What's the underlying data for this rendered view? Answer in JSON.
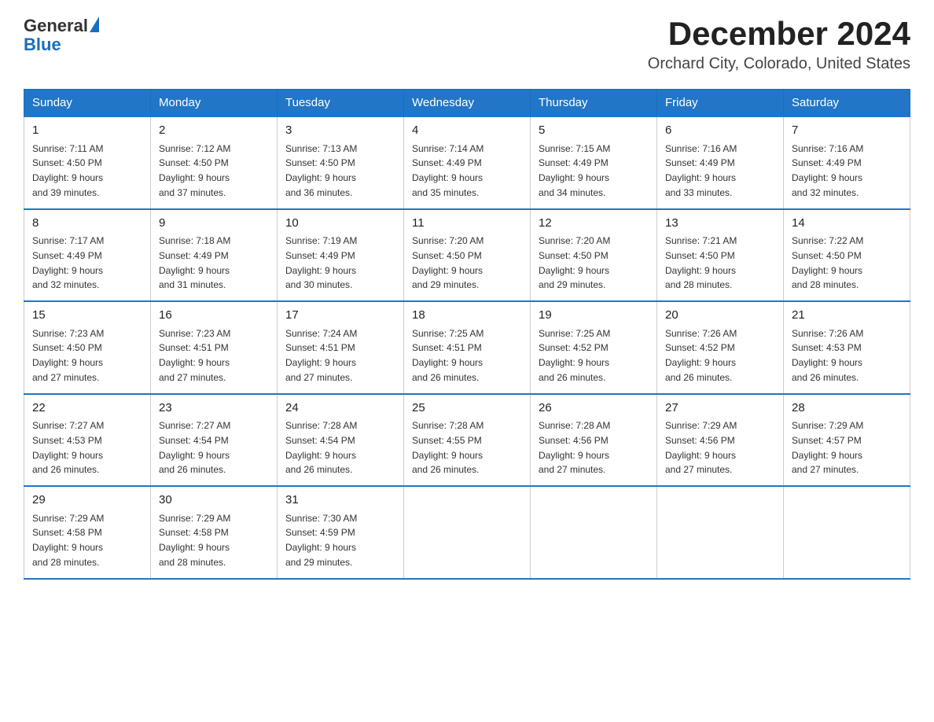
{
  "header": {
    "logo_general": "General",
    "logo_blue": "Blue",
    "month_title": "December 2024",
    "subtitle": "Orchard City, Colorado, United States"
  },
  "days_of_week": [
    "Sunday",
    "Monday",
    "Tuesday",
    "Wednesday",
    "Thursday",
    "Friday",
    "Saturday"
  ],
  "weeks": [
    [
      {
        "day": "1",
        "sunrise": "7:11 AM",
        "sunset": "4:50 PM",
        "daylight": "9 hours and 39 minutes."
      },
      {
        "day": "2",
        "sunrise": "7:12 AM",
        "sunset": "4:50 PM",
        "daylight": "9 hours and 37 minutes."
      },
      {
        "day": "3",
        "sunrise": "7:13 AM",
        "sunset": "4:50 PM",
        "daylight": "9 hours and 36 minutes."
      },
      {
        "day": "4",
        "sunrise": "7:14 AM",
        "sunset": "4:49 PM",
        "daylight": "9 hours and 35 minutes."
      },
      {
        "day": "5",
        "sunrise": "7:15 AM",
        "sunset": "4:49 PM",
        "daylight": "9 hours and 34 minutes."
      },
      {
        "day": "6",
        "sunrise": "7:16 AM",
        "sunset": "4:49 PM",
        "daylight": "9 hours and 33 minutes."
      },
      {
        "day": "7",
        "sunrise": "7:16 AM",
        "sunset": "4:49 PM",
        "daylight": "9 hours and 32 minutes."
      }
    ],
    [
      {
        "day": "8",
        "sunrise": "7:17 AM",
        "sunset": "4:49 PM",
        "daylight": "9 hours and 32 minutes."
      },
      {
        "day": "9",
        "sunrise": "7:18 AM",
        "sunset": "4:49 PM",
        "daylight": "9 hours and 31 minutes."
      },
      {
        "day": "10",
        "sunrise": "7:19 AM",
        "sunset": "4:49 PM",
        "daylight": "9 hours and 30 minutes."
      },
      {
        "day": "11",
        "sunrise": "7:20 AM",
        "sunset": "4:50 PM",
        "daylight": "9 hours and 29 minutes."
      },
      {
        "day": "12",
        "sunrise": "7:20 AM",
        "sunset": "4:50 PM",
        "daylight": "9 hours and 29 minutes."
      },
      {
        "day": "13",
        "sunrise": "7:21 AM",
        "sunset": "4:50 PM",
        "daylight": "9 hours and 28 minutes."
      },
      {
        "day": "14",
        "sunrise": "7:22 AM",
        "sunset": "4:50 PM",
        "daylight": "9 hours and 28 minutes."
      }
    ],
    [
      {
        "day": "15",
        "sunrise": "7:23 AM",
        "sunset": "4:50 PM",
        "daylight": "9 hours and 27 minutes."
      },
      {
        "day": "16",
        "sunrise": "7:23 AM",
        "sunset": "4:51 PM",
        "daylight": "9 hours and 27 minutes."
      },
      {
        "day": "17",
        "sunrise": "7:24 AM",
        "sunset": "4:51 PM",
        "daylight": "9 hours and 27 minutes."
      },
      {
        "day": "18",
        "sunrise": "7:25 AM",
        "sunset": "4:51 PM",
        "daylight": "9 hours and 26 minutes."
      },
      {
        "day": "19",
        "sunrise": "7:25 AM",
        "sunset": "4:52 PM",
        "daylight": "9 hours and 26 minutes."
      },
      {
        "day": "20",
        "sunrise": "7:26 AM",
        "sunset": "4:52 PM",
        "daylight": "9 hours and 26 minutes."
      },
      {
        "day": "21",
        "sunrise": "7:26 AM",
        "sunset": "4:53 PM",
        "daylight": "9 hours and 26 minutes."
      }
    ],
    [
      {
        "day": "22",
        "sunrise": "7:27 AM",
        "sunset": "4:53 PM",
        "daylight": "9 hours and 26 minutes."
      },
      {
        "day": "23",
        "sunrise": "7:27 AM",
        "sunset": "4:54 PM",
        "daylight": "9 hours and 26 minutes."
      },
      {
        "day": "24",
        "sunrise": "7:28 AM",
        "sunset": "4:54 PM",
        "daylight": "9 hours and 26 minutes."
      },
      {
        "day": "25",
        "sunrise": "7:28 AM",
        "sunset": "4:55 PM",
        "daylight": "9 hours and 26 minutes."
      },
      {
        "day": "26",
        "sunrise": "7:28 AM",
        "sunset": "4:56 PM",
        "daylight": "9 hours and 27 minutes."
      },
      {
        "day": "27",
        "sunrise": "7:29 AM",
        "sunset": "4:56 PM",
        "daylight": "9 hours and 27 minutes."
      },
      {
        "day": "28",
        "sunrise": "7:29 AM",
        "sunset": "4:57 PM",
        "daylight": "9 hours and 27 minutes."
      }
    ],
    [
      {
        "day": "29",
        "sunrise": "7:29 AM",
        "sunset": "4:58 PM",
        "daylight": "9 hours and 28 minutes."
      },
      {
        "day": "30",
        "sunrise": "7:29 AM",
        "sunset": "4:58 PM",
        "daylight": "9 hours and 28 minutes."
      },
      {
        "day": "31",
        "sunrise": "7:30 AM",
        "sunset": "4:59 PM",
        "daylight": "9 hours and 29 minutes."
      },
      null,
      null,
      null,
      null
    ]
  ],
  "labels": {
    "sunrise": "Sunrise: ",
    "sunset": "Sunset: ",
    "daylight": "Daylight: "
  }
}
